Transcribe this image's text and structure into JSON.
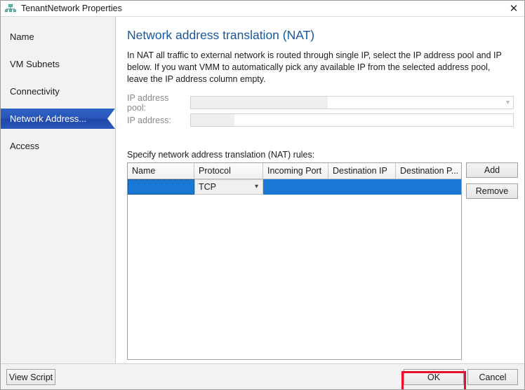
{
  "window": {
    "title": "TenantNetwork Properties",
    "icon": "network-icon",
    "close_label": "✕"
  },
  "sidebar": {
    "items": [
      {
        "label": "Name",
        "selected": false
      },
      {
        "label": "VM Subnets",
        "selected": false
      },
      {
        "label": "Connectivity",
        "selected": false
      },
      {
        "label": "Network Address...",
        "selected": true
      },
      {
        "label": "Access",
        "selected": false
      }
    ]
  },
  "panel": {
    "title": "Network address translation (NAT)",
    "description": "In NAT all traffic to external network is routed through single IP, select the IP address pool and IP below. If you want VMM to automatically pick any available IP from the selected address pool, leave the IP address column empty.",
    "fields": [
      {
        "label": "IP address pool:",
        "value": "",
        "type": "combobox",
        "disabled": true
      },
      {
        "label": "IP address:",
        "value": "",
        "type": "textbox",
        "disabled": true
      }
    ],
    "rules_caption": "Specify network address translation (NAT) rules:",
    "grid": {
      "columns": [
        "Name",
        "Protocol",
        "Incoming Port",
        "Destination IP",
        "Destination P..."
      ],
      "rows": [
        {
          "name": "",
          "protocol": "TCP",
          "incoming_port": "",
          "destination_ip": "",
          "destination_port": "",
          "selected": true
        }
      ]
    },
    "grid_buttons": [
      {
        "label": "Add"
      },
      {
        "label": "Remove"
      }
    ]
  },
  "footer": {
    "view_script_label": "View Script",
    "ok_label": "OK",
    "cancel_label": "Cancel"
  },
  "annotation": {
    "color": "#e8112d",
    "target": "ok-button"
  }
}
